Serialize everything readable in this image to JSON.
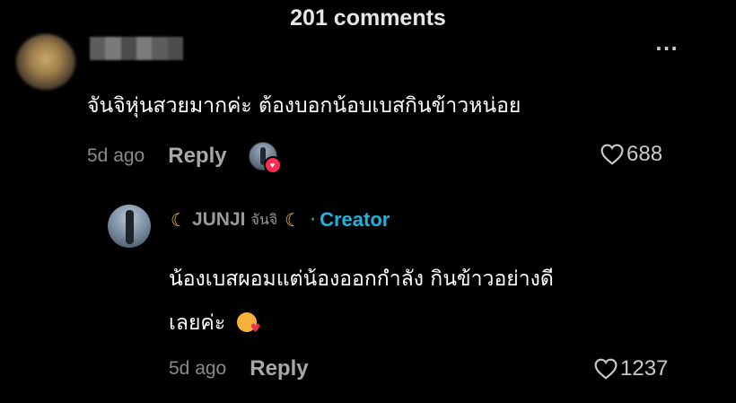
{
  "header": {
    "title": "201 comments"
  },
  "comment": {
    "text": "จันจิหุ่นสวยมากค่ะ ต้องบอกน้อบเบสกินข้าวหน่อย",
    "time": "5d ago",
    "reply_label": "Reply",
    "likes": "688"
  },
  "reply": {
    "author": "JUNJI",
    "author_thai": "จันจิ",
    "badge_dot": "·",
    "badge": "Creator",
    "line1": "น้องเบสผอมแต่น้องออกกำลัง กินข้าวอย่างดี",
    "line2": "เลยค่ะ",
    "time": "5d ago",
    "reply_label": "Reply",
    "likes": "1237"
  },
  "icons": {
    "more": "more-horizontal-icon",
    "heart": "heart-outline-icon",
    "moon": "crescent-moon-emoji-icon",
    "emoji": "smiling-face-with-hearts-emoji-icon"
  },
  "colors": {
    "background": "#000000",
    "creator_accent": "#1fb2e0",
    "muted_text": "#8a8a8a",
    "like_badge": "#fe2c55"
  }
}
